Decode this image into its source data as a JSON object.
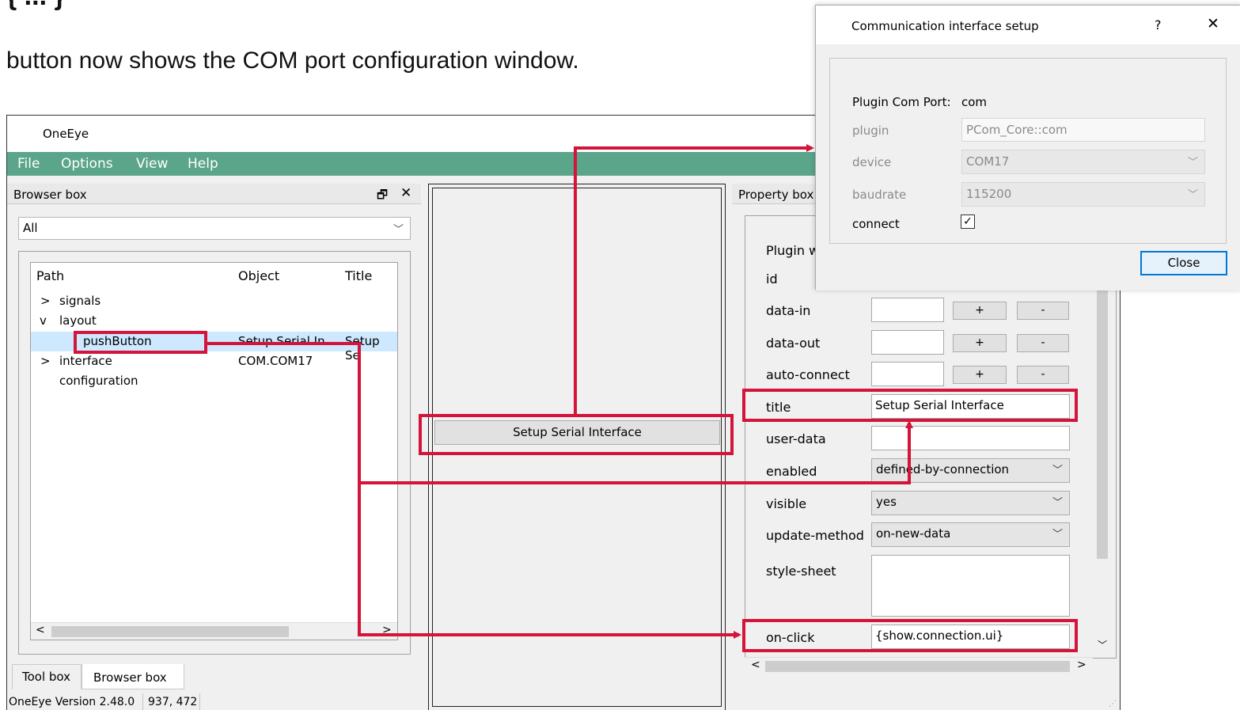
{
  "caption": {
    "top_fragment": "{ ... }",
    "line": "button now shows the COM port configuration window."
  },
  "window": {
    "title": "OneEye"
  },
  "menu": {
    "file": "File",
    "options": "Options",
    "view": "View",
    "help": "Help"
  },
  "browser_box": {
    "title": "Browser box",
    "filter_value": "All",
    "columns": {
      "path": "Path",
      "object": "Object",
      "title": "Title"
    },
    "rows": [
      {
        "expander": ">",
        "path": "signals",
        "object": "",
        "title": ""
      },
      {
        "expander": "v",
        "path": "layout",
        "object": "",
        "title": ""
      },
      {
        "expander": "",
        "path": "pushButton",
        "object": "Setup Serial In...",
        "title": "Setup Se"
      },
      {
        "expander": ">",
        "path": "interface",
        "object": "COM.COM17",
        "title": ""
      },
      {
        "expander": "",
        "path": "configuration",
        "object": "",
        "title": ""
      }
    ]
  },
  "tabs": {
    "tool_box": "Tool box",
    "browser_box": "Browser box"
  },
  "status": {
    "version": "OneEye Version 2.48.0",
    "coords": "937, 472"
  },
  "canvas": {
    "button_label": "Setup Serial Interface"
  },
  "property_box": {
    "title": "Property box",
    "section_label": "Plugin w",
    "id_label": "id",
    "rows": {
      "data_in": {
        "label": "data-in",
        "plus": "+",
        "minus": "-"
      },
      "data_out": {
        "label": "data-out",
        "plus": "+",
        "minus": "-"
      },
      "auto_connect": {
        "label": "auto-connect",
        "plus": "+",
        "minus": "-"
      },
      "title": {
        "label": "title",
        "value": "Setup Serial Interface"
      },
      "user_data": {
        "label": "user-data",
        "value": ""
      },
      "enabled": {
        "label": "enabled",
        "value": "defined-by-connection"
      },
      "visible": {
        "label": "visible",
        "value": "yes"
      },
      "update_method": {
        "label": "update-method",
        "value": "on-new-data"
      },
      "style_sheet": {
        "label": "style-sheet",
        "value": ""
      },
      "on_click": {
        "label": "on-click",
        "value": "{show.connection.ui}"
      }
    }
  },
  "dialog": {
    "title": "Communication interface setup",
    "help_symbol": "?",
    "close_symbol": "✕",
    "plugin_com_port_label": "Plugin Com Port:",
    "plugin_com_port_value": "com",
    "plugin_label": "plugin",
    "plugin_value": "PCom_Core::com",
    "device_label": "device",
    "device_value": "COM17",
    "baudrate_label": "baudrate",
    "baudrate_value": "115200",
    "connect_label": "connect",
    "connect_checked": true,
    "close_button": "Close"
  },
  "colors": {
    "menu_bar": "#5ba58b",
    "annotation": "#d4143a",
    "selection": "#cde8ff"
  }
}
